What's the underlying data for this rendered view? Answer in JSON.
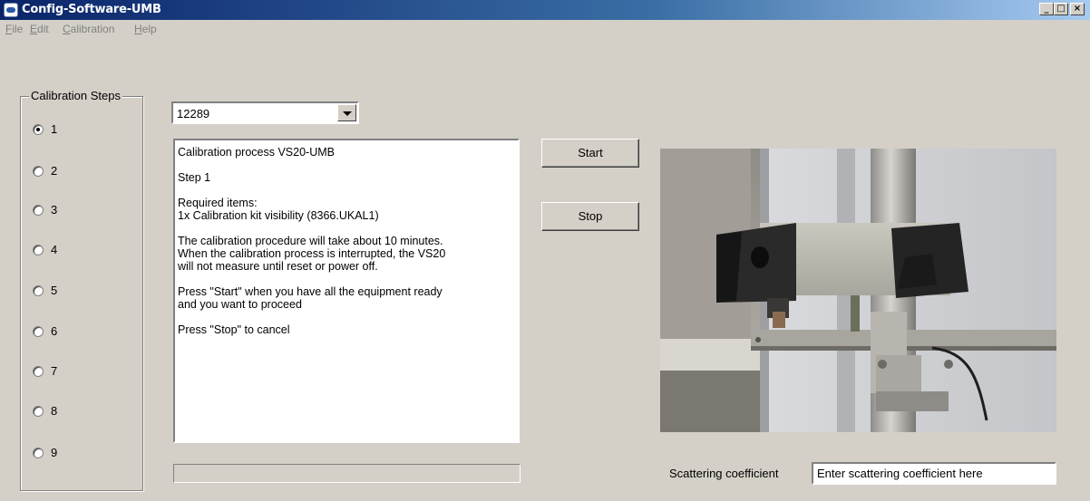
{
  "window": {
    "title": "Config-Software-UMB",
    "minimize": "_",
    "maximize": "□",
    "close": "×"
  },
  "menu": [
    "File",
    "Edit",
    "Calibration",
    "Help"
  ],
  "calibration_steps": {
    "label": "Calibration Steps",
    "steps": [
      "1",
      "2",
      "3",
      "4",
      "5",
      "6",
      "7",
      "8",
      "9"
    ],
    "selected": "1"
  },
  "device_select": {
    "value": "12289"
  },
  "instructions": {
    "text": "Calibration process VS20-UMB\n\nStep 1\n\nRequired items:\n1x Calibration kit visibility (8366.UKAL1)\n\nThe calibration procedure will take about 10 minutes.\nWhen the calibration process is interrupted, the VS20\nwill not measure until reset or power off.\n\nPress \"Start\" when you have all the equipment ready\nand you want to proceed\n\nPress \"Stop\" to cancel"
  },
  "buttons": {
    "start": "Start",
    "stop": "Stop"
  },
  "progress": {
    "value": 0
  },
  "scattering": {
    "label": "Scattering coefficient",
    "placeholder": "Enter scattering coefficient here"
  },
  "colors": {
    "titlebar_start": "#0a246a",
    "titlebar_end": "#a6caf0",
    "window_bg": "#d4d0c8"
  }
}
